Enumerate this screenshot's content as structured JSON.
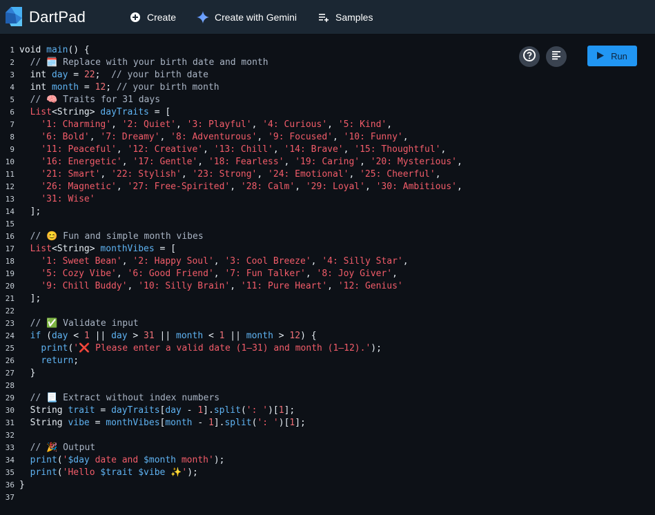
{
  "header": {
    "title": "DartPad",
    "create_label": "Create",
    "gemini_label": "Create with Gemini",
    "samples_label": "Samples"
  },
  "toolbar": {
    "run_label": "Run"
  },
  "colors": {
    "header_bg": "#1b2733",
    "editor_bg": "#0d1117",
    "run_button": "#2196f3",
    "string": "#f25c69",
    "keyword": "#5fb3f2",
    "comment": "#a9b4c4"
  },
  "code_lines": [
    [
      [
        "pl",
        "void "
      ],
      [
        "id",
        "main"
      ],
      [
        "pl",
        "() {"
      ]
    ],
    [
      [
        "cm",
        "  // 🗓️ Replace with your birth date and month"
      ]
    ],
    [
      [
        "pl",
        "  int "
      ],
      [
        "id",
        "day"
      ],
      [
        "pl",
        " = "
      ],
      [
        "num",
        "22"
      ],
      [
        "pl",
        ";  "
      ],
      [
        "cm",
        "// your birth date"
      ]
    ],
    [
      [
        "pl",
        "  int "
      ],
      [
        "id",
        "month"
      ],
      [
        "pl",
        " = "
      ],
      [
        "num",
        "12"
      ],
      [
        "pl",
        "; "
      ],
      [
        "cm",
        "// your birth month"
      ]
    ],
    [
      [
        "cm",
        "  // 🧠 Traits for 31 days"
      ]
    ],
    [
      [
        "pl",
        "  "
      ],
      [
        "ty",
        "List"
      ],
      [
        "pl",
        "<String> "
      ],
      [
        "id",
        "dayTraits"
      ],
      [
        "pl",
        " = ["
      ]
    ],
    [
      [
        "pl",
        "    "
      ],
      [
        "str",
        "'1: Charming'"
      ],
      [
        "pl",
        ", "
      ],
      [
        "str",
        "'2: Quiet'"
      ],
      [
        "pl",
        ", "
      ],
      [
        "str",
        "'3: Playful'"
      ],
      [
        "pl",
        ", "
      ],
      [
        "str",
        "'4: Curious'"
      ],
      [
        "pl",
        ", "
      ],
      [
        "str",
        "'5: Kind'"
      ],
      [
        "pl",
        ","
      ]
    ],
    [
      [
        "pl",
        "    "
      ],
      [
        "str",
        "'6: Bold'"
      ],
      [
        "pl",
        ", "
      ],
      [
        "str",
        "'7: Dreamy'"
      ],
      [
        "pl",
        ", "
      ],
      [
        "str",
        "'8: Adventurous'"
      ],
      [
        "pl",
        ", "
      ],
      [
        "str",
        "'9: Focused'"
      ],
      [
        "pl",
        ", "
      ],
      [
        "str",
        "'10: Funny'"
      ],
      [
        "pl",
        ","
      ]
    ],
    [
      [
        "pl",
        "    "
      ],
      [
        "str",
        "'11: Peaceful'"
      ],
      [
        "pl",
        ", "
      ],
      [
        "str",
        "'12: Creative'"
      ],
      [
        "pl",
        ", "
      ],
      [
        "str",
        "'13: Chill'"
      ],
      [
        "pl",
        ", "
      ],
      [
        "str",
        "'14: Brave'"
      ],
      [
        "pl",
        ", "
      ],
      [
        "str",
        "'15: Thoughtful'"
      ],
      [
        "pl",
        ","
      ]
    ],
    [
      [
        "pl",
        "    "
      ],
      [
        "str",
        "'16: Energetic'"
      ],
      [
        "pl",
        ", "
      ],
      [
        "str",
        "'17: Gentle'"
      ],
      [
        "pl",
        ", "
      ],
      [
        "str",
        "'18: Fearless'"
      ],
      [
        "pl",
        ", "
      ],
      [
        "str",
        "'19: Caring'"
      ],
      [
        "pl",
        ", "
      ],
      [
        "str",
        "'20: Mysterious'"
      ],
      [
        "pl",
        ","
      ]
    ],
    [
      [
        "pl",
        "    "
      ],
      [
        "str",
        "'21: Smart'"
      ],
      [
        "pl",
        ", "
      ],
      [
        "str",
        "'22: Stylish'"
      ],
      [
        "pl",
        ", "
      ],
      [
        "str",
        "'23: Strong'"
      ],
      [
        "pl",
        ", "
      ],
      [
        "str",
        "'24: Emotional'"
      ],
      [
        "pl",
        ", "
      ],
      [
        "str",
        "'25: Cheerful'"
      ],
      [
        "pl",
        ","
      ]
    ],
    [
      [
        "pl",
        "    "
      ],
      [
        "str",
        "'26: Magnetic'"
      ],
      [
        "pl",
        ", "
      ],
      [
        "str",
        "'27: Free-Spirited'"
      ],
      [
        "pl",
        ", "
      ],
      [
        "str",
        "'28: Calm'"
      ],
      [
        "pl",
        ", "
      ],
      [
        "str",
        "'29: Loyal'"
      ],
      [
        "pl",
        ", "
      ],
      [
        "str",
        "'30: Ambitious'"
      ],
      [
        "pl",
        ","
      ]
    ],
    [
      [
        "pl",
        "    "
      ],
      [
        "str",
        "'31: Wise'"
      ]
    ],
    [
      [
        "pl",
        "  ];"
      ]
    ],
    [
      [
        "pl",
        ""
      ]
    ],
    [
      [
        "cm",
        "  // 😊 Fun and simple month vibes"
      ]
    ],
    [
      [
        "pl",
        "  "
      ],
      [
        "ty",
        "List"
      ],
      [
        "pl",
        "<String> "
      ],
      [
        "id",
        "monthVibes"
      ],
      [
        "pl",
        " = ["
      ]
    ],
    [
      [
        "pl",
        "    "
      ],
      [
        "str",
        "'1: Sweet Bean'"
      ],
      [
        "pl",
        ", "
      ],
      [
        "str",
        "'2: Happy Soul'"
      ],
      [
        "pl",
        ", "
      ],
      [
        "str",
        "'3: Cool Breeze'"
      ],
      [
        "pl",
        ", "
      ],
      [
        "str",
        "'4: Silly Star'"
      ],
      [
        "pl",
        ","
      ]
    ],
    [
      [
        "pl",
        "    "
      ],
      [
        "str",
        "'5: Cozy Vibe'"
      ],
      [
        "pl",
        ", "
      ],
      [
        "str",
        "'6: Good Friend'"
      ],
      [
        "pl",
        ", "
      ],
      [
        "str",
        "'7: Fun Talker'"
      ],
      [
        "pl",
        ", "
      ],
      [
        "str",
        "'8: Joy Giver'"
      ],
      [
        "pl",
        ","
      ]
    ],
    [
      [
        "pl",
        "    "
      ],
      [
        "str",
        "'9: Chill Buddy'"
      ],
      [
        "pl",
        ", "
      ],
      [
        "str",
        "'10: Silly Brain'"
      ],
      [
        "pl",
        ", "
      ],
      [
        "str",
        "'11: Pure Heart'"
      ],
      [
        "pl",
        ", "
      ],
      [
        "str",
        "'12: Genius'"
      ]
    ],
    [
      [
        "pl",
        "  ];"
      ]
    ],
    [
      [
        "pl",
        ""
      ]
    ],
    [
      [
        "cm",
        "  // ✅ Validate input"
      ]
    ],
    [
      [
        "pl",
        "  "
      ],
      [
        "kw",
        "if"
      ],
      [
        "pl",
        " ("
      ],
      [
        "id",
        "day"
      ],
      [
        "pl",
        " < "
      ],
      [
        "num",
        "1"
      ],
      [
        "pl",
        " || "
      ],
      [
        "id",
        "day"
      ],
      [
        "pl",
        " > "
      ],
      [
        "num",
        "31"
      ],
      [
        "pl",
        " || "
      ],
      [
        "id",
        "month"
      ],
      [
        "pl",
        " < "
      ],
      [
        "num",
        "1"
      ],
      [
        "pl",
        " || "
      ],
      [
        "id",
        "month"
      ],
      [
        "pl",
        " > "
      ],
      [
        "num",
        "12"
      ],
      [
        "pl",
        ") {"
      ]
    ],
    [
      [
        "pl",
        "    "
      ],
      [
        "fn",
        "print"
      ],
      [
        "pl",
        "("
      ],
      [
        "str",
        "'❌ Please enter a valid date (1–31) and month (1–12).'"
      ],
      [
        "pl",
        ");"
      ]
    ],
    [
      [
        "pl",
        "    "
      ],
      [
        "kw",
        "return"
      ],
      [
        "pl",
        ";"
      ]
    ],
    [
      [
        "pl",
        "  }"
      ]
    ],
    [
      [
        "pl",
        ""
      ]
    ],
    [
      [
        "cm",
        "  // 📃 Extract without index numbers"
      ]
    ],
    [
      [
        "pl",
        "  String "
      ],
      [
        "id",
        "trait"
      ],
      [
        "pl",
        " = "
      ],
      [
        "id",
        "dayTraits"
      ],
      [
        "pl",
        "["
      ],
      [
        "id",
        "day"
      ],
      [
        "pl",
        " - "
      ],
      [
        "num",
        "1"
      ],
      [
        "pl",
        "]."
      ],
      [
        "fn",
        "split"
      ],
      [
        "pl",
        "("
      ],
      [
        "str",
        "': '"
      ],
      [
        "pl",
        ")["
      ],
      [
        "num",
        "1"
      ],
      [
        "pl",
        "];"
      ]
    ],
    [
      [
        "pl",
        "  String "
      ],
      [
        "id",
        "vibe"
      ],
      [
        "pl",
        " = "
      ],
      [
        "id",
        "monthVibes"
      ],
      [
        "pl",
        "["
      ],
      [
        "id",
        "month"
      ],
      [
        "pl",
        " - "
      ],
      [
        "num",
        "1"
      ],
      [
        "pl",
        "]."
      ],
      [
        "fn",
        "split"
      ],
      [
        "pl",
        "("
      ],
      [
        "str",
        "': '"
      ],
      [
        "pl",
        ")["
      ],
      [
        "num",
        "1"
      ],
      [
        "pl",
        "];"
      ]
    ],
    [
      [
        "pl",
        ""
      ]
    ],
    [
      [
        "cm",
        "  // 🎉 Output"
      ]
    ],
    [
      [
        "pl",
        "  "
      ],
      [
        "fn",
        "print"
      ],
      [
        "pl",
        "("
      ],
      [
        "str",
        "'"
      ],
      [
        "id",
        "$day"
      ],
      [
        "str",
        " date and "
      ],
      [
        "id",
        "$month"
      ],
      [
        "str",
        " month'"
      ],
      [
        "pl",
        ");"
      ]
    ],
    [
      [
        "pl",
        "  "
      ],
      [
        "fn",
        "print"
      ],
      [
        "pl",
        "("
      ],
      [
        "str",
        "'Hello "
      ],
      [
        "id",
        "$trait"
      ],
      [
        "str",
        " "
      ],
      [
        "id",
        "$vibe"
      ],
      [
        "str",
        " ✨'"
      ],
      [
        "pl",
        ");"
      ]
    ],
    [
      [
        "pl",
        "}"
      ]
    ],
    [
      [
        "pl",
        ""
      ]
    ]
  ]
}
